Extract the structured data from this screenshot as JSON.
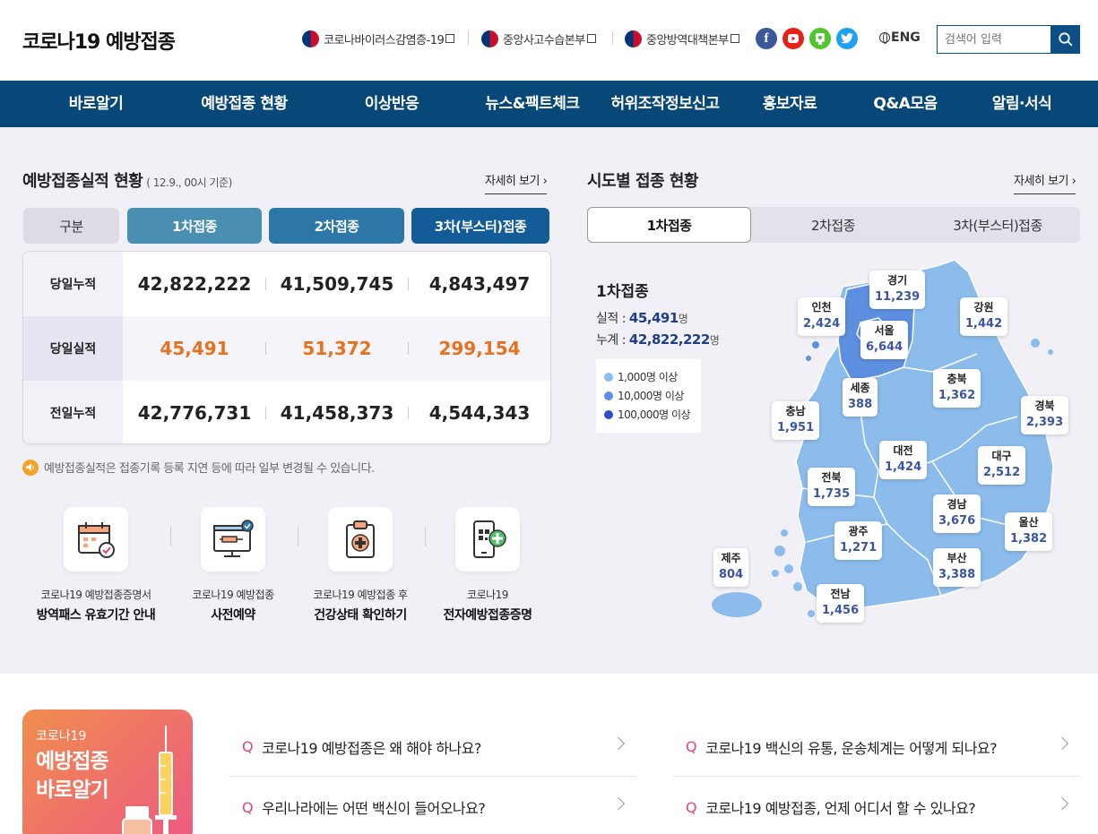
{
  "header": {
    "logo": "코로나19 예방접종",
    "links": [
      "코로나바이러스감염증-19",
      "중앙사고수습본부",
      "중앙방역대책본부"
    ],
    "sns": [
      "facebook-icon",
      "youtube-icon",
      "kakao-story-icon",
      "twitter-icon"
    ],
    "eng": "ENG",
    "search_placeholder": "검색어 입력"
  },
  "nav": [
    "바로알기",
    "예방접종 현황",
    "이상반응",
    "뉴스&팩트체크",
    "허위조작정보신고",
    "홍보자료",
    "Q&A모음",
    "알림·서식"
  ],
  "stats": {
    "title": "예방접종실적 현황",
    "subtitle": "( 12.9., 00시 기준)",
    "more": "자세히 보기",
    "headers": [
      "구분",
      "1차접종",
      "2차접종",
      "3차(부스터)접종"
    ],
    "header_colors": [
      "#dcdbe6",
      "#4a8fb2",
      "#2c76a8",
      "#135c98"
    ],
    "rows": [
      {
        "label": "당일누적",
        "values": [
          "42,822,222",
          "41,509,745",
          "4,843,497"
        ]
      },
      {
        "label": "당일실적",
        "values": [
          "45,491",
          "51,372",
          "299,154"
        ]
      },
      {
        "label": "전일누적",
        "values": [
          "42,776,731",
          "41,458,373",
          "4,544,343"
        ]
      }
    ],
    "notice": "예방접종실적은 접종기록 등록 지연 등에 따라 일부 변경될 수 있습니다."
  },
  "quick_links": [
    {
      "line1": "코로나19 예방접종증명서",
      "line2": "방역패스 유효기간 안내",
      "icon": "calendar-check-icon"
    },
    {
      "line1": "코로나19 예방접종",
      "line2": "사전예약",
      "icon": "monitor-syringe-icon"
    },
    {
      "line1": "코로나19 예방접종 후",
      "line2": "건강상태 확인하기",
      "icon": "clipboard-medical-icon"
    },
    {
      "line1": "코로나19",
      "line2": "전자예방접종증명",
      "icon": "phone-qr-plus-icon"
    }
  ],
  "map": {
    "title": "시도별 접종 현황",
    "more": "자세히 보기",
    "tabs": [
      "1차접종",
      "2차접종",
      "3차(부스터)접종"
    ],
    "info_title": "1차접종",
    "daily_label": "실적 :",
    "daily_value": "45,491",
    "total_label": "누계 :",
    "total_value": "42,822,222",
    "unit": "명",
    "legend": [
      {
        "label": "1,000명 이상",
        "color": "#8bbcec"
      },
      {
        "label": "10,000명 이상",
        "color": "#5d8fe0"
      },
      {
        "label": "100,000명 이상",
        "color": "#2f4fbf"
      }
    ],
    "regions": [
      {
        "name": "경기",
        "value": "11,239"
      },
      {
        "name": "인천",
        "value": "2,424"
      },
      {
        "name": "강원",
        "value": "1,442"
      },
      {
        "name": "서울",
        "value": "6,644"
      },
      {
        "name": "충북",
        "value": "1,362"
      },
      {
        "name": "세종",
        "value": "388"
      },
      {
        "name": "충남",
        "value": "1,951"
      },
      {
        "name": "경북",
        "value": "2,393"
      },
      {
        "name": "대전",
        "value": "1,424"
      },
      {
        "name": "대구",
        "value": "2,512"
      },
      {
        "name": "전북",
        "value": "1,735"
      },
      {
        "name": "경남",
        "value": "3,676"
      },
      {
        "name": "울산",
        "value": "1,382"
      },
      {
        "name": "광주",
        "value": "1,271"
      },
      {
        "name": "제주",
        "value": "804"
      },
      {
        "name": "부산",
        "value": "3,388"
      },
      {
        "name": "전남",
        "value": "1,456"
      }
    ]
  },
  "banner": {
    "small": "코로나19",
    "big1": "예방접종",
    "big2": "바로알기"
  },
  "faq": [
    "코로나19 예방접종은 왜 해야 하나요?",
    "코로나19 백신의 유통, 운송체계는 어떻게 되나요?",
    "우리나라에는 어떤 백신이 들어오나요?",
    "코로나19 예방접종, 언제 어디서 할 수 있나요?"
  ],
  "faq_marker": "Q"
}
